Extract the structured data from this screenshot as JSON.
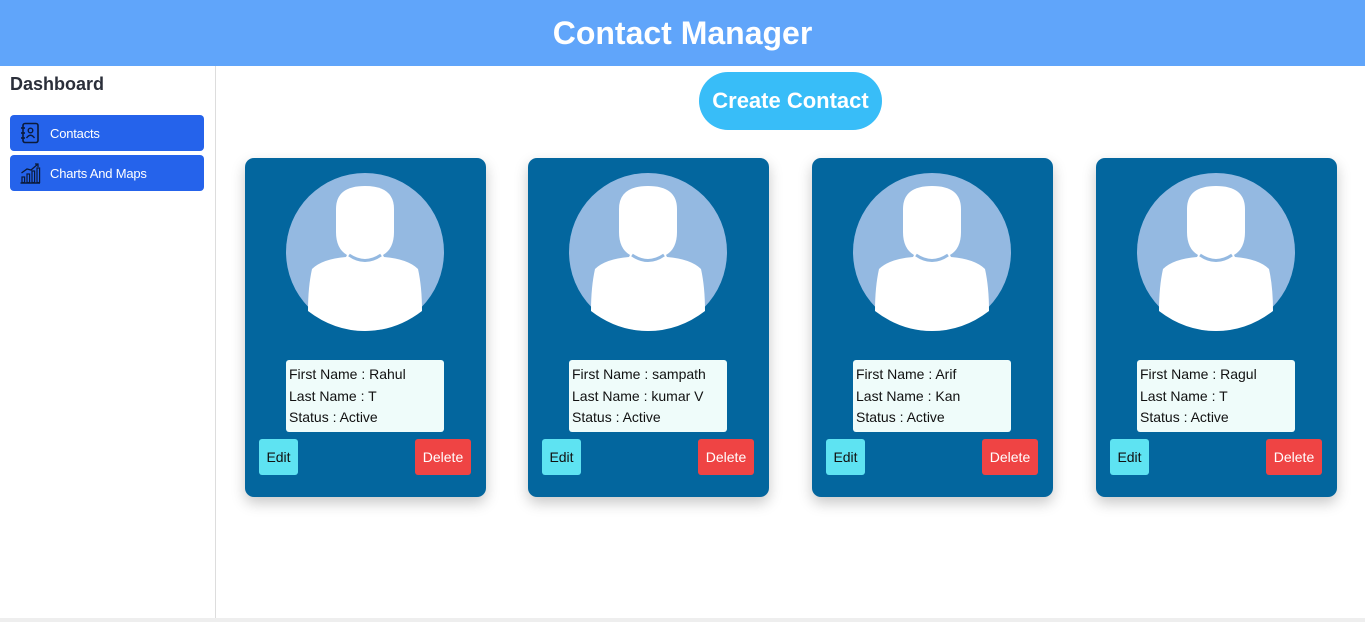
{
  "header": {
    "title": "Contact Manager",
    "bg_color": "#60a5fa"
  },
  "sidebar": {
    "title": "Dashboard",
    "items": [
      {
        "label": "Contacts",
        "icon": "contacts-book-icon"
      },
      {
        "label": "Charts And Maps",
        "icon": "bar-chart-icon"
      }
    ],
    "item_color": "#2563eb"
  },
  "main": {
    "create_label": "Create Contact",
    "contacts": [
      {
        "first": "First Name : Rahul",
        "last": "Last Name : T",
        "status": "Status : Active",
        "edit": "Edit",
        "delete": "Delete"
      },
      {
        "first": "First Name : sampath",
        "last": "Last Name : kumar V",
        "status": "Status : Active",
        "edit": "Edit",
        "delete": "Delete"
      },
      {
        "first": "First Name : Arif",
        "last": "Last Name : Kan",
        "status": "Status : Active",
        "edit": "Edit",
        "delete": "Delete"
      },
      {
        "first": "First Name : Ragul",
        "last": "Last Name : T",
        "status": "Status : Active",
        "edit": "Edit",
        "delete": "Delete"
      }
    ],
    "card_color": "#03669e",
    "edit_color": "#5ee3f2",
    "delete_color": "#ef4444"
  }
}
